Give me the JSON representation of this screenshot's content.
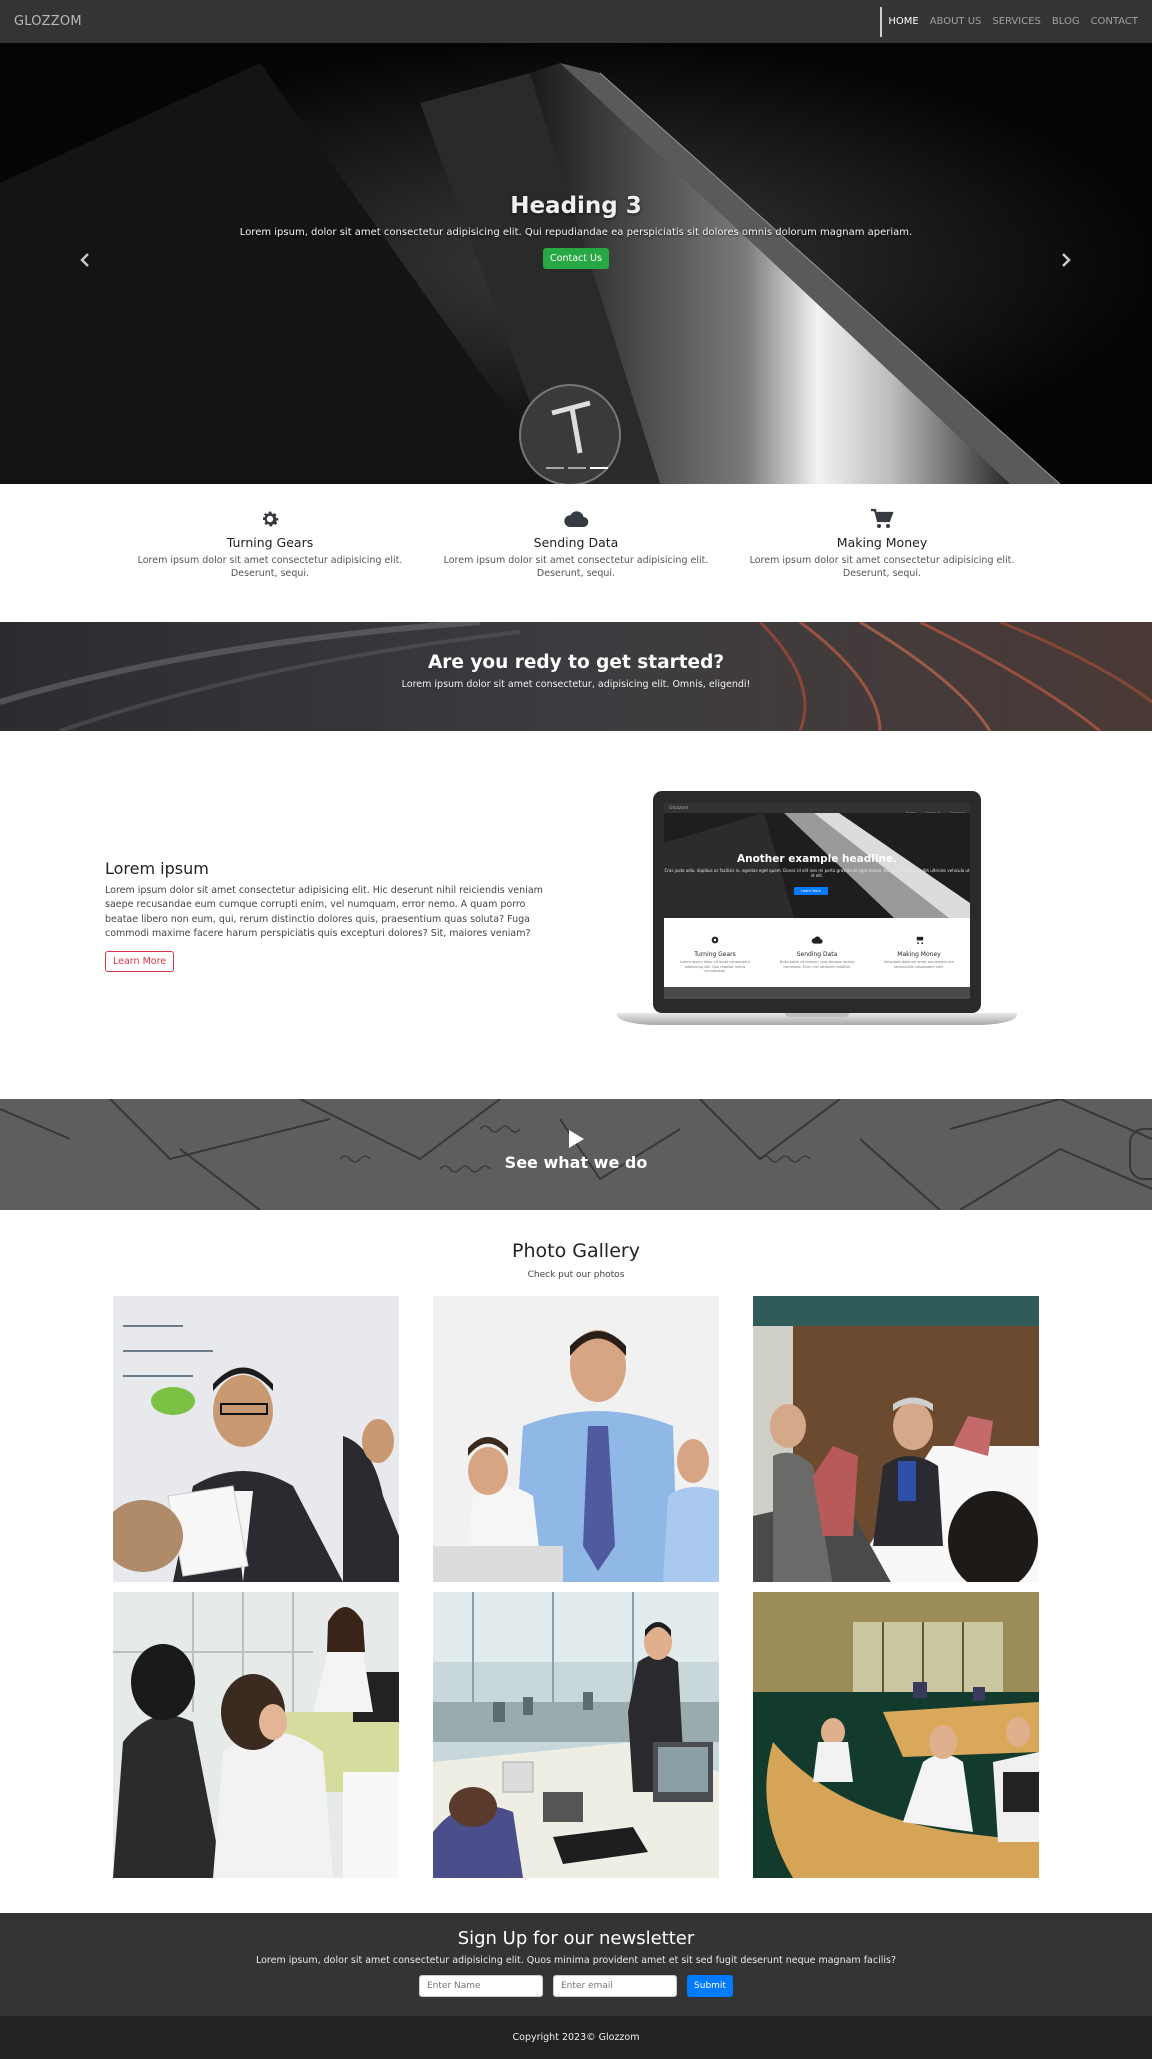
{
  "navbar": {
    "brand": "GLOZZOM",
    "links": [
      "HOME",
      "ABOUT US",
      "SERVICES",
      "BLOG",
      "CONTACT"
    ]
  },
  "hero": {
    "title": "Heading 3",
    "text": "Lorem ipsum, dolor sit amet consectetur adipisicing elit. Qui repudiandae ea perspiciatis sit dolores omnis dolorum magnam aperiam.",
    "button": "Contact Us",
    "prev_icon": "chevron-left-icon",
    "next_icon": "chevron-right-icon",
    "slide_count": 3,
    "active_slide": 2,
    "button_color": "#28a745"
  },
  "features": [
    {
      "icon": "gear-icon",
      "title": "Turning Gears",
      "text": "Lorem ipsum dolor sit amet consectetur adipisicing elit. Deserunt, sequi."
    },
    {
      "icon": "cloud-icon",
      "title": "Sending Data",
      "text": "Lorem ipsum dolor sit amet consectetur adipisicing elit. Deserunt, sequi."
    },
    {
      "icon": "cart-icon",
      "title": "Making Money",
      "text": "Lorem ipsum dolor sit amet consectetur adipisicing elit. Deserunt, sequi."
    }
  ],
  "cta": {
    "title": "Are you redy to get started?",
    "text": "Lorem ipsum dolor sit amet consectetur, adipisicing elit. Omnis, eligendi!"
  },
  "about": {
    "title": "Lorem ipsum",
    "body": "Lorem ipsum dolor sit amet consectetur adipisicing elit. Hic deserunt nihil reiciendis veniam saepe recusandae eum cumque corrupti enim, vel numquam, error nemo. A quam porro beatae libero non eum, qui, rerum distinctio dolores quis, praesentium quas soluta? Fuga commodi maxime facere harum perspiciatis quis excepturi dolores? Sit, maiores veniam?",
    "button": "Learn More",
    "button_color": "#dc3545",
    "mockup": {
      "brand": "Glozzom",
      "nav": [
        "Home",
        "About Us",
        "Services"
      ],
      "headline": "Another example headline.",
      "sub": "Cras justo odio, dapibus ac facilisis in, egestas eget quam. Donec id elit non mi porta gravida at eget metus. Nullam id dolor id nibh ultricies vehicula ut id elit.",
      "button": "Learn More",
      "features": [
        {
          "icon": "gear-icon",
          "title": "Turning Gears",
          "text": "Lorem ipsum dolor sit amet consectetur adipisicing elit. Quo repellat minus recusandae."
        },
        {
          "icon": "cloud-icon",
          "title": "Sending Data",
          "text": "Nulla porta sit tempor, quis tempus lacinia commodo. Enim nisi rationem mollitia."
        },
        {
          "icon": "cart-icon",
          "title": "Making Money",
          "text": "Voluptate dolorum amet accusamus aut perspiciatis voluptatem nihil."
        }
      ]
    }
  },
  "video": {
    "icon": "play-icon",
    "title": "See what we do"
  },
  "gallery": {
    "title": "Photo Gallery",
    "subtitle": "Check put our photos",
    "photos": [
      {
        "name": "photo-presenter"
      },
      {
        "name": "photo-man-in-tie"
      },
      {
        "name": "photo-meeting-table"
      },
      {
        "name": "photo-office-colleagues"
      },
      {
        "name": "photo-cubicle-office"
      },
      {
        "name": "photo-open-plan-office"
      }
    ]
  },
  "newsletter": {
    "title": "Sign Up for our newsletter",
    "text": "Lorem ipsum, dolor sit amet consectetur adipisicing elit. Quos minima provident amet et sit sed fugit deserunt neque magnam facilis?",
    "name_placeholder": "Enter Name",
    "email_placeholder": "Enter email",
    "submit": "Submit",
    "submit_color": "#007bff"
  },
  "footer": {
    "copyright": "Copyright 2023© Glozzom"
  }
}
